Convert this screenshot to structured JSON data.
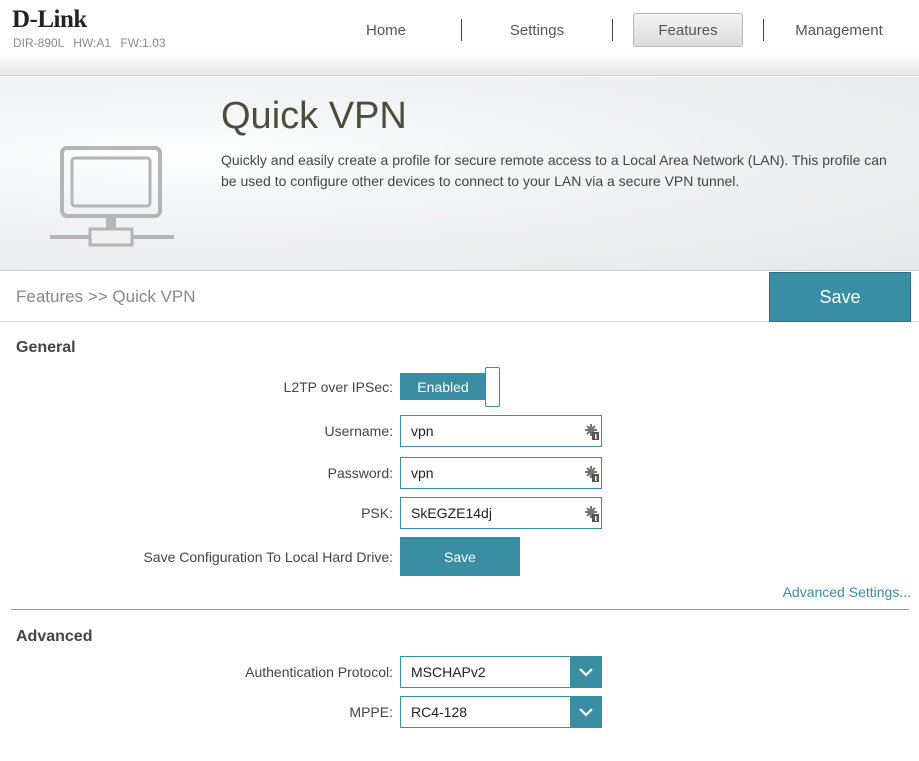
{
  "header": {
    "brand": "D-Link",
    "model": "DIR-890L",
    "hw": "HW:A1",
    "fw": "FW:1.03",
    "nav": [
      {
        "label": "Home"
      },
      {
        "label": "Settings"
      },
      {
        "label": "Features",
        "active": true
      },
      {
        "label": "Management"
      }
    ]
  },
  "banner": {
    "title": "Quick VPN",
    "description": "Quickly and easily create a profile for secure remote access to a Local Area Network (LAN). This profile can be used to configure other devices to connect to your LAN via a secure VPN tunnel.",
    "icon": "network-monitor-icon"
  },
  "breadcrumb": "Features >> Quick VPN",
  "save_label": "Save",
  "general": {
    "title": "General",
    "l2tp_label": "L2TP over IPSec:",
    "l2tp_state": "Enabled",
    "username_label": "Username:",
    "username_value": "vpn",
    "password_label": "Password:",
    "password_value": "vpn",
    "psk_label": "PSK:",
    "psk_value": "SkEGZE14dj",
    "save_config_label": "Save Configuration To Local Hard Drive:",
    "save_config_button": "Save",
    "advanced_link": "Advanced Settings..."
  },
  "advanced": {
    "title": "Advanced",
    "auth_label": "Authentication Protocol:",
    "auth_value": "MSCHAPv2",
    "mppe_label": "MPPE:",
    "mppe_value": "RC4-128"
  },
  "colors": {
    "accent": "#3a8ea3",
    "title": "#4a4f3a"
  }
}
